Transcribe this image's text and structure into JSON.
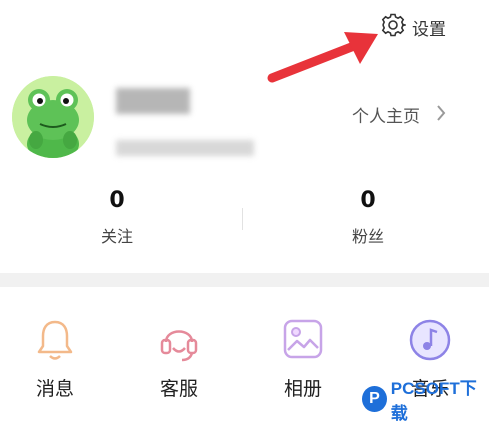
{
  "header": {
    "settings_label": "设置",
    "settings_icon": "gear-icon",
    "annotation_arrow_color": "#e8333a"
  },
  "profile": {
    "avatar_icon": "frog-avatar",
    "homepage_label": "个人主页",
    "homepage_icon": "chevron-right-icon"
  },
  "stats": [
    {
      "value": "0",
      "label": "关注"
    },
    {
      "value": "0",
      "label": "粉丝"
    }
  ],
  "menu": [
    {
      "label": "消息",
      "icon": "bell-icon",
      "color": "#f3b98a"
    },
    {
      "label": "客服",
      "icon": "headset-icon",
      "color": "#e58a9a"
    },
    {
      "label": "相册",
      "icon": "album-icon",
      "color": "#c7a4e8"
    },
    {
      "label": "音乐",
      "icon": "music-icon",
      "color": "#8d83e6"
    }
  ],
  "watermark": {
    "text": "PCSOFT下载"
  }
}
